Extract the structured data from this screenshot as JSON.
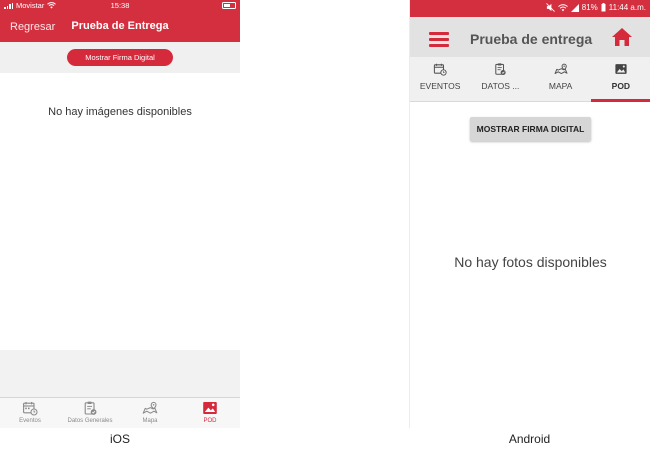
{
  "colors": {
    "brand_red": "#d32f3f",
    "accent_red": "#d52a3c"
  },
  "ios": {
    "status": {
      "carrier": "Movistar",
      "time": "15:38"
    },
    "nav": {
      "back_label": "Regresar",
      "title": "Prueba de Entrega"
    },
    "signature_button_label": "Mostrar Firma Digital",
    "empty_message": "No hay imágenes disponibles",
    "tabs": [
      {
        "label": "Eventos",
        "icon": "calendar-clock-icon",
        "active": false
      },
      {
        "label": "Datos Generales",
        "icon": "clipboard-check-icon",
        "active": false
      },
      {
        "label": "Mapa",
        "icon": "map-icon",
        "active": false
      },
      {
        "label": "POD",
        "icon": "image-icon",
        "active": true
      }
    ],
    "caption": "iOS"
  },
  "android": {
    "status": {
      "battery": "81%",
      "time": "11:44 a.m."
    },
    "appbar": {
      "title": "Prueba de entrega",
      "menu_icon": "hamburger-icon",
      "home_icon": "home-icon"
    },
    "tabs": [
      {
        "label": "EVENTOS",
        "icon": "calendar-clock-icon",
        "active": false
      },
      {
        "label": "DATOS ...",
        "icon": "clipboard-check-icon",
        "active": false
      },
      {
        "label": "MAPA",
        "icon": "map-icon",
        "active": false
      },
      {
        "label": "POD",
        "icon": "image-icon",
        "active": true
      }
    ],
    "signature_button_label": "MOSTRAR FIRMA DIGITAL",
    "empty_message": "No hay fotos disponibles",
    "caption": "Android"
  }
}
